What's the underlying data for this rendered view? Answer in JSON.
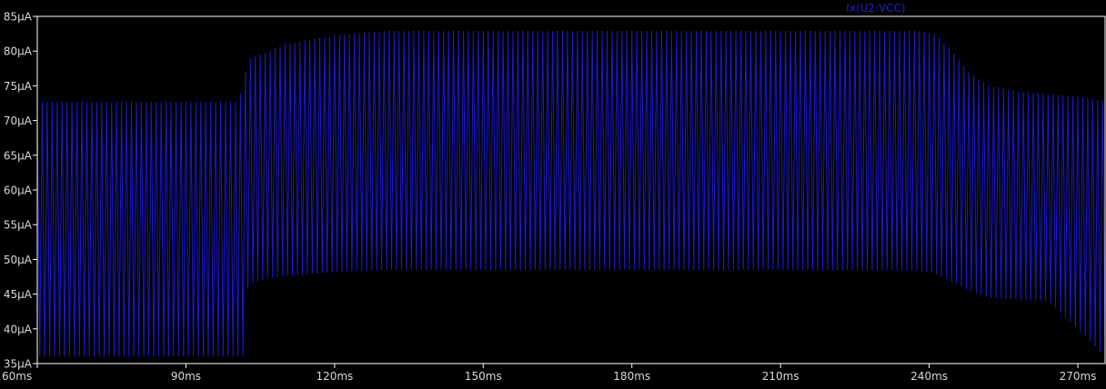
{
  "colors": {
    "background": "#000000",
    "axis": "#ffffff",
    "text": "#d8d8d8",
    "trace": "#1a1ad2",
    "legend": "#1f1fd6"
  },
  "chart_data": {
    "type": "line",
    "title": "",
    "xlabel": "",
    "ylabel": "",
    "xlim": [
      60,
      275.5
    ],
    "ylim": [
      35,
      85
    ],
    "grid": false,
    "legend_placement": "top-center",
    "x_ticks": [
      60,
      90,
      120,
      150,
      180,
      210,
      240,
      270
    ],
    "x_tick_labels": [
      "60ms",
      "90ms",
      "120ms",
      "150ms",
      "180ms",
      "210ms",
      "240ms",
      "270ms"
    ],
    "y_ticks": [
      35,
      40,
      45,
      50,
      55,
      60,
      65,
      70,
      75,
      80,
      85
    ],
    "y_tick_labels": [
      "35µA",
      "40µA",
      "45µA",
      "50µA",
      "55µA",
      "60µA",
      "65µA",
      "70µA",
      "75µA",
      "80µA",
      "85µA"
    ],
    "series": [
      {
        "name": "Ix(U2:VCC)",
        "oscillation_period_ms": 1.0,
        "envelope": {
          "time_ms": [
            60,
            100,
            101.5,
            102,
            103,
            105,
            110,
            120,
            130,
            150,
            180,
            210,
            238,
            241,
            244,
            248,
            252,
            258,
            264,
            270,
            275.5
          ],
          "max_uA": [
            72.7,
            72.7,
            74.5,
            77,
            79,
            79.5,
            81,
            82.3,
            82.9,
            82.9,
            82.9,
            82.9,
            82.9,
            82.5,
            80.5,
            77,
            75,
            74.2,
            73.8,
            73.5,
            72.8
          ],
          "min_uA": [
            36,
            36,
            36,
            45,
            46.5,
            47,
            47.6,
            48.2,
            48.5,
            48.5,
            48.5,
            48.5,
            48.4,
            48,
            47,
            45.5,
            44.5,
            44.2,
            44,
            40,
            36
          ]
        }
      }
    ]
  }
}
